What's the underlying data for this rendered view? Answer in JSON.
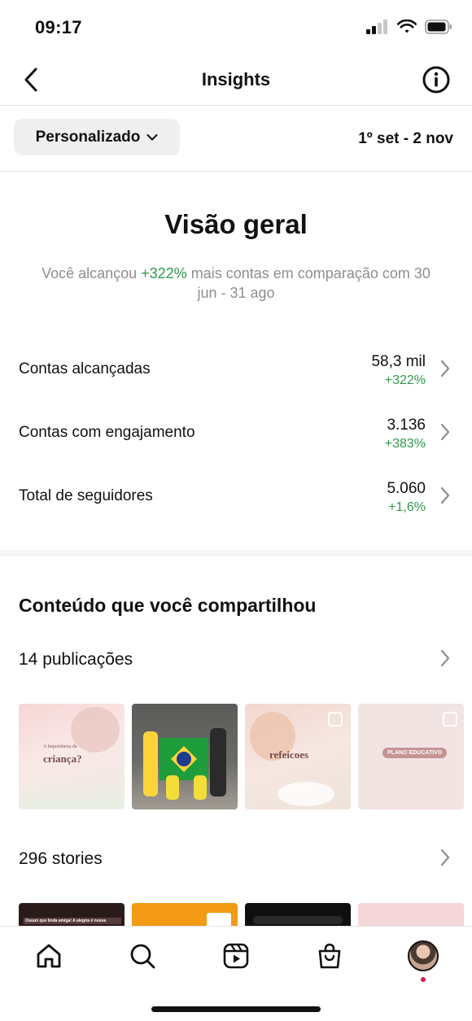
{
  "status": {
    "time": "09:17"
  },
  "header": {
    "title": "Insights"
  },
  "filter": {
    "period_label": "Personalizado",
    "date_range": "1º set - 2 nov"
  },
  "overview": {
    "title": "Visão geral",
    "sub_prefix": "Você alcançou ",
    "sub_highlight": "+322%",
    "sub_suffix": " mais contas em comparação com 30 jun - 31 ago"
  },
  "metrics": [
    {
      "label": "Contas alcançadas",
      "value": "58,3 mil",
      "change": "+322%"
    },
    {
      "label": "Contas com engajamento",
      "value": "3.136",
      "change": "+383%"
    },
    {
      "label": "Total de seguidores",
      "value": "5.060",
      "change": "+1,6%"
    }
  ],
  "content": {
    "title": "Conteúdo que você compartilhou",
    "posts_label": "14 publicações",
    "stories_label": "296 stories",
    "thumbs": [
      {
        "lines": [
          "A Importância da",
          "criança?"
        ]
      },
      {
        "lines": []
      },
      {
        "lines": [
          "refeicoes"
        ]
      },
      {
        "lines": [
          "PLANO EDUCATIVO"
        ]
      }
    ],
    "stories": [
      {
        "text": "Ouuun que linda amiga! A alegria é nossa"
      },
      {
        "text": ""
      },
      {
        "text": ""
      },
      {
        "text": ""
      }
    ]
  },
  "colors": {
    "positive": "#2d9a4a",
    "muted": "#8e8e8e",
    "notification_dot": "#e4154b"
  }
}
